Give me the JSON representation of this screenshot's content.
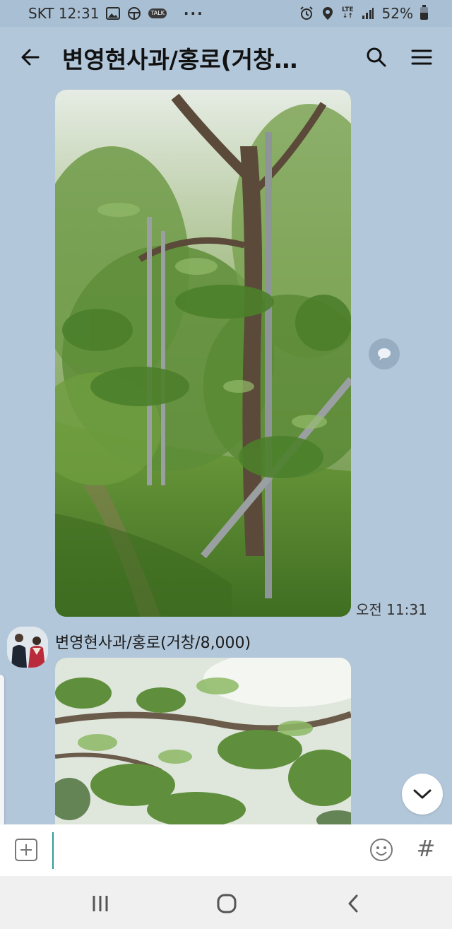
{
  "status_bar": {
    "carrier_time": "SKT 12:31",
    "talk_badge": "TALK",
    "more": "···",
    "network": "LTE",
    "battery": "52%",
    "icons": [
      "gallery-icon",
      "steering-wheel-icon",
      "talk-icon",
      "alarm-icon",
      "location-icon",
      "lte-icon",
      "signal-icon",
      "battery-icon"
    ]
  },
  "header": {
    "title": "변영현사과/홍로(거창…",
    "back_icon": "back-arrow-icon",
    "search_icon": "search-icon",
    "menu_icon": "hamburger-menu-icon"
  },
  "messages": [
    {
      "type": "photo",
      "subject": "apple orchard",
      "time": "오전 11:31"
    },
    {
      "sender": "변영현사과/홍로(거창/8,000)",
      "type": "photo",
      "subject": "apple branches"
    }
  ],
  "input_bar": {
    "placeholder": "",
    "attach_icon": "plus-box-icon",
    "emoji_icon": "emoji-icon",
    "hashtag_label": "#"
  },
  "nav_bar": {
    "icons": [
      "recent-apps-icon",
      "home-icon",
      "back-icon"
    ]
  },
  "colors": {
    "chat_background": "#b2c7da",
    "input_background": "#ffffff",
    "nav_background": "#f0f0f0"
  }
}
